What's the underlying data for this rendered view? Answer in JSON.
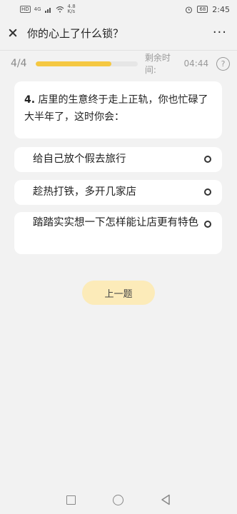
{
  "status_bar": {
    "sim_label": "HD",
    "network": "4G",
    "speed_value": "4.8",
    "speed_unit": "K/s",
    "battery": "68",
    "time": "2:45"
  },
  "nav": {
    "title": "你的心上了什么锁？",
    "more_label": "···"
  },
  "progress": {
    "counter": "4/4",
    "fraction": 0.74,
    "timer_label": "剩余时间:",
    "timer_value": "04:44",
    "help_label": "?"
  },
  "question": {
    "number": "4.",
    "text": " 店里的生意终于走上正轨，你也忙碌了大半年了，这时你会："
  },
  "options": [
    {
      "label": "给自己放个假去旅行"
    },
    {
      "label": "趁热打铁，多开几家店"
    },
    {
      "label": "踏踏实实想一下怎样能让店更有特色"
    }
  ],
  "prev_button": {
    "label": "上一题"
  }
}
